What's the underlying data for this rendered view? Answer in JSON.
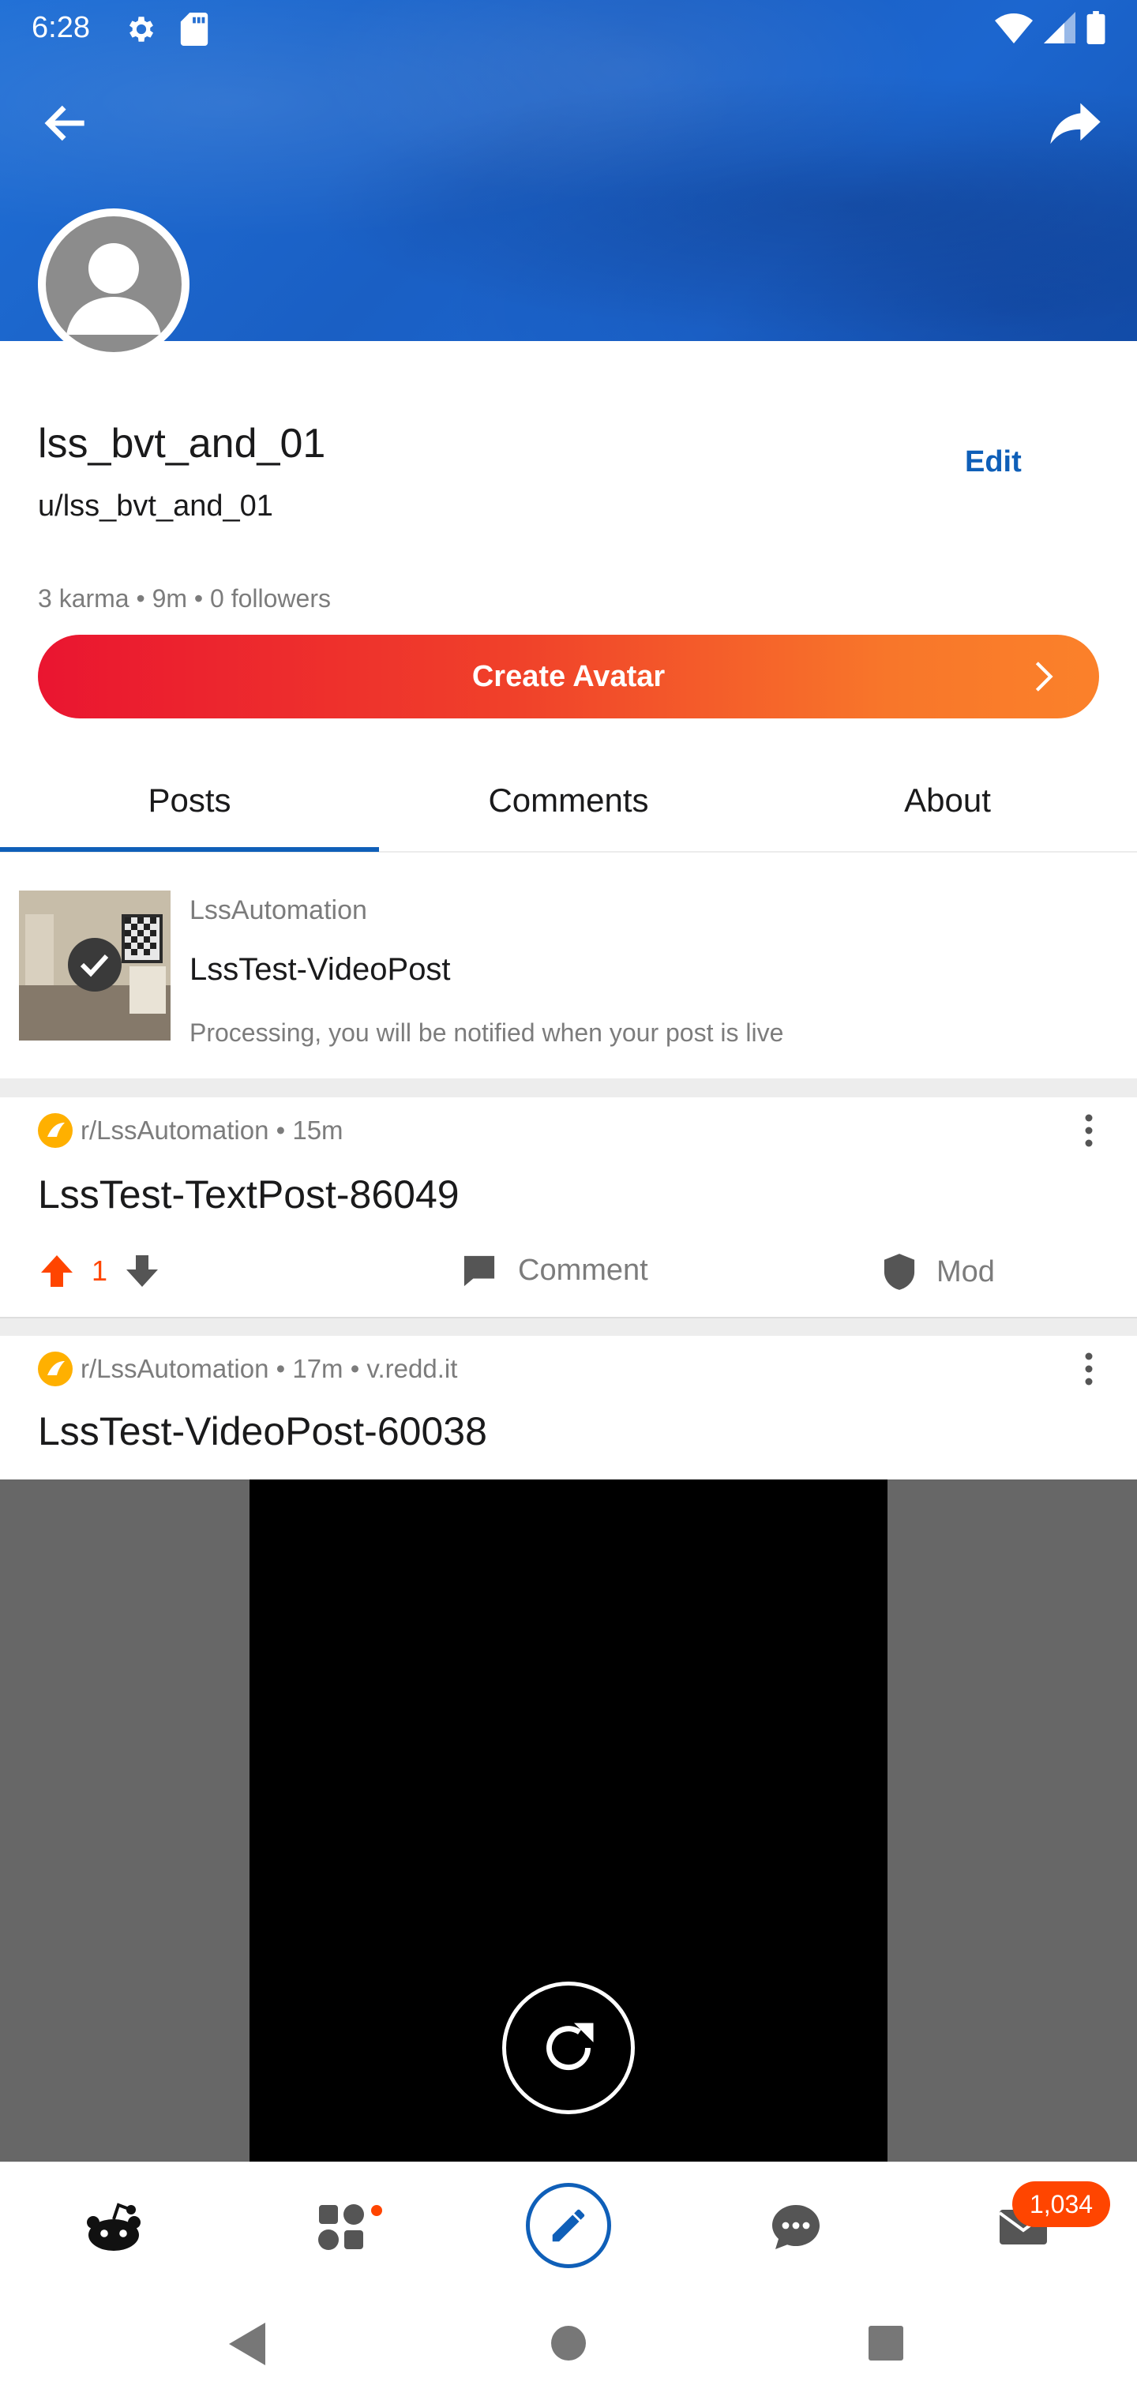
{
  "status_bar": {
    "time": "6:28",
    "icons": [
      "gear-icon",
      "sd-card-icon",
      "wifi-icon",
      "signal-icon",
      "battery-icon"
    ]
  },
  "header": {
    "back_icon": "arrow-left-icon",
    "share_icon": "share-arrow-icon",
    "banner_color": "#1a5fc4"
  },
  "profile": {
    "display_name": "lss_bvt_and_01",
    "username": "u/lss_bvt_and_01",
    "edit_label": "Edit",
    "stats": "3 karma • 9m • 0 followers",
    "create_avatar_label": "Create Avatar"
  },
  "tabs": [
    {
      "label": "Posts",
      "active": true
    },
    {
      "label": "Comments",
      "active": false
    },
    {
      "label": "About",
      "active": false
    }
  ],
  "processing_post": {
    "community": "LssAutomation",
    "title": "LssTest-VideoPost",
    "message": "Processing, you will be notified when your post is live"
  },
  "posts": [
    {
      "meta": "r/LssAutomation • 15m",
      "title": "LssTest-TextPost-86049",
      "votes": "1",
      "comment_label": "Comment",
      "mod_label": "Mod"
    },
    {
      "meta": "r/LssAutomation • 17m • v.redd.it",
      "title": "LssTest-VideoPost-60038"
    }
  ],
  "bottom_nav": {
    "items": [
      "home-icon",
      "communities-icon",
      "create-icon",
      "chat-icon",
      "inbox-icon"
    ],
    "inbox_badge": "1,034"
  },
  "colors": {
    "accent_blue": "#0f5fb8",
    "upvote_orange": "#ff4500",
    "avatar_gradient_start": "#ea1530",
    "avatar_gradient_end": "#fb812a"
  }
}
